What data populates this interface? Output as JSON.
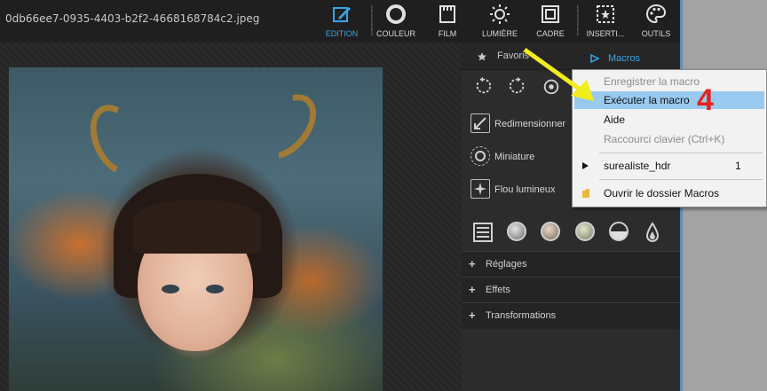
{
  "window": {
    "filename": "0db66ee7-0935-4403-b2f2-4668168784c2.jpeg"
  },
  "toolbar": {
    "items": [
      {
        "label": "EDITION",
        "icon": "edit-icon",
        "active": true
      },
      {
        "label": "COULEUR",
        "icon": "color-ring-icon",
        "active": false
      },
      {
        "label": "FILM",
        "icon": "film-icon",
        "active": false
      },
      {
        "label": "LUMIÈRE",
        "icon": "sun-icon",
        "active": false
      },
      {
        "label": "CADRE",
        "icon": "frame-icon",
        "active": false
      },
      {
        "label": "INSERTI...",
        "icon": "star-box-icon",
        "active": false
      },
      {
        "label": "OUTILS",
        "icon": "palette-icon",
        "active": false
      }
    ],
    "accent_color": "#3aa3e8"
  },
  "panel": {
    "favoris_label": "Favoris",
    "macros_label": "Macros",
    "functions": [
      {
        "label": "Redimensionner",
        "icon": "resize-icon"
      },
      {
        "label": "Miniature",
        "icon": "vignette-icon"
      },
      {
        "label": "Flou lumineux",
        "icon": "sparkle-icon"
      }
    ],
    "sections": [
      {
        "label": "Réglages"
      },
      {
        "label": "Effets"
      },
      {
        "label": "Transformations"
      }
    ]
  },
  "macro_menu": {
    "items": [
      {
        "label": "Enregistrer la macro",
        "enabled": false
      },
      {
        "label": "Exécuter la macro",
        "enabled": true,
        "highlighted": true
      },
      {
        "label": "Aide",
        "enabled": true
      },
      {
        "label": "Raccourci clavier (Ctrl+K)",
        "enabled": false
      },
      {
        "label": "surealiste_hdr",
        "enabled": true,
        "count": "1"
      },
      {
        "label": "Ouvrir le dossier Macros",
        "enabled": true
      }
    ],
    "highlight_color": "#99c9ef"
  },
  "annotation": {
    "step": "4",
    "arrow_color": "#f2ec1c",
    "step_color": "#e4231b"
  }
}
